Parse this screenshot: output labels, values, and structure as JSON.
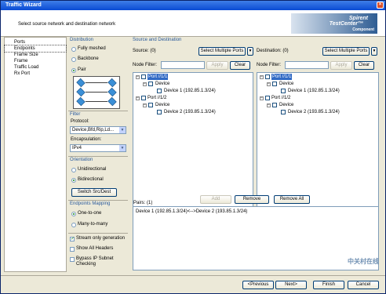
{
  "window": {
    "title": "Traffic Wizard"
  },
  "header": {
    "subtitle": "Select source network and destination network",
    "logo_line1": "Spirent",
    "logo_line2": "TestCenter™",
    "logo_line3": "Component"
  },
  "nav": {
    "items": [
      "Ports",
      "Endpoints",
      "Frame Size",
      "Frame",
      "Traffic Load",
      "Rx Port"
    ],
    "selected": "Endpoints"
  },
  "distribution": {
    "title": "Distribution",
    "options": [
      "Fully meshed",
      "Backbone",
      "Pair"
    ],
    "selected": "Pair"
  },
  "filter": {
    "title": "Filter",
    "protocol_label": "Protocol:",
    "protocol_value": "Device,Bfd,Rip,Ld...",
    "encapsulation_label": "Encapsulation:",
    "encapsulation_value": "IPv4"
  },
  "orientation": {
    "title": "Orientation",
    "options": [
      "Unidirectional",
      "Bidirectional"
    ],
    "selected": "Bidirectional",
    "switch_button": "Switch Src/Dest"
  },
  "endpoints_mapping": {
    "title": "Endpoints Mapping",
    "options": [
      "One-to-one",
      "Many-to-many"
    ],
    "selected": "One-to-one"
  },
  "checkboxes": {
    "stream_only": {
      "label": "Stream only generation",
      "checked": true
    },
    "show_all_headers": {
      "label": "Show All Headers",
      "checked": false
    },
    "bypass_ip": {
      "label": "Bypass IP Subnet Checking",
      "checked": false
    }
  },
  "source_dest": {
    "title": "Source and Destination"
  },
  "source": {
    "label": "Source: (0)",
    "select_multiple": "Select Multiple Ports",
    "node_filter_label": "Node Filter:",
    "apply": "Apply",
    "clear": "Clear",
    "tree": {
      "port1": "Port //1/1",
      "device_label": "Device",
      "device1": "Device 1 (192.85.1.3/24)",
      "port2": "Port //1/2",
      "device2": "Device 2 (193.85.1.3/24)"
    }
  },
  "destination": {
    "label": "Destination: (0)",
    "select_multiple": "Select Multiple Ports",
    "node_filter_label": "Node Filter:",
    "apply": "Apply",
    "clear": "Clear",
    "tree": {
      "port1": "Port //1/1",
      "device_label": "Device",
      "device1": "Device 1 (192.85.1.3/24)",
      "port2": "Port //1/2",
      "device2": "Device 2 (193.85.1.3/24)"
    }
  },
  "pairs_actions": {
    "add": "Add",
    "remove": "Remove",
    "remove_all": "Remove All"
  },
  "pairs": {
    "label": "Pairs: (1)",
    "items": [
      "Device 1 (192.85.1.3/24)<-->Device 2 (193.85.1.3/24)"
    ]
  },
  "footer": {
    "previous": "<Previous",
    "next": "Next>",
    "finish": "Finish",
    "cancel": "Cancel"
  },
  "watermark": "中关村在线"
}
